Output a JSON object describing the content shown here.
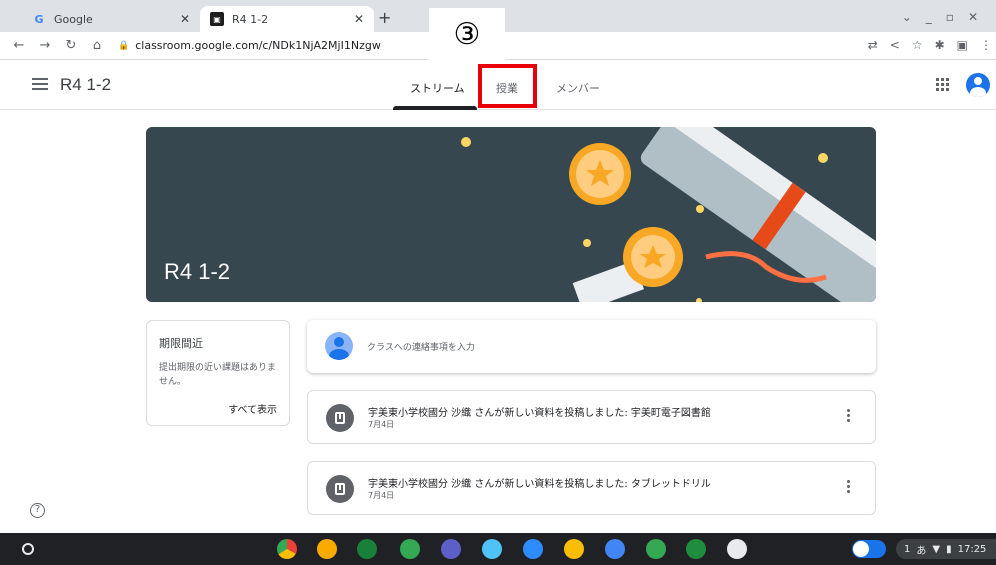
{
  "browser": {
    "tabs": [
      {
        "title": "Google",
        "favicon": "google-g-icon"
      },
      {
        "title": "R4 1-2",
        "favicon": "classroom-icon"
      }
    ],
    "url": "classroom.google.com/c/NDk1NjA2MjI1Nzgw"
  },
  "annotation": {
    "step_number": "③",
    "highlight_color": "#e8000b"
  },
  "classroom": {
    "class_name": "R4 1-2",
    "tabs": [
      {
        "label": "ストリーム",
        "active": true
      },
      {
        "label": "授業",
        "active": false
      },
      {
        "label": "メンバー",
        "active": false
      }
    ],
    "banner_title": "R4 1-2",
    "upcoming": {
      "title": "期限間近",
      "body": "提出期限の近い課題はありません。",
      "view_all": "すべて表示"
    },
    "announce_placeholder": "クラスへの連絡事項を入力",
    "posts": [
      {
        "text": "宇美東小学校國分 沙織 さんが新しい資料を投稿しました: 宇美町電子図書館",
        "date": "7月4日"
      },
      {
        "text": "宇美東小学校國分 沙織 さんが新しい資料を投稿しました: タブレットドリル",
        "date": "7月4日"
      }
    ]
  },
  "shelf": {
    "time": "17:25",
    "ime": "あ",
    "notification_count": "1",
    "apps": [
      "chrome-icon",
      "app-icon",
      "app-icon",
      "app-icon",
      "teams-icon",
      "app-icon",
      "zoom-icon",
      "app-icon",
      "docs-icon",
      "sheets-icon",
      "classroom-icon",
      "app-icon"
    ]
  },
  "colors": {
    "banner": "#37474f",
    "accent": "#1a73e8"
  }
}
